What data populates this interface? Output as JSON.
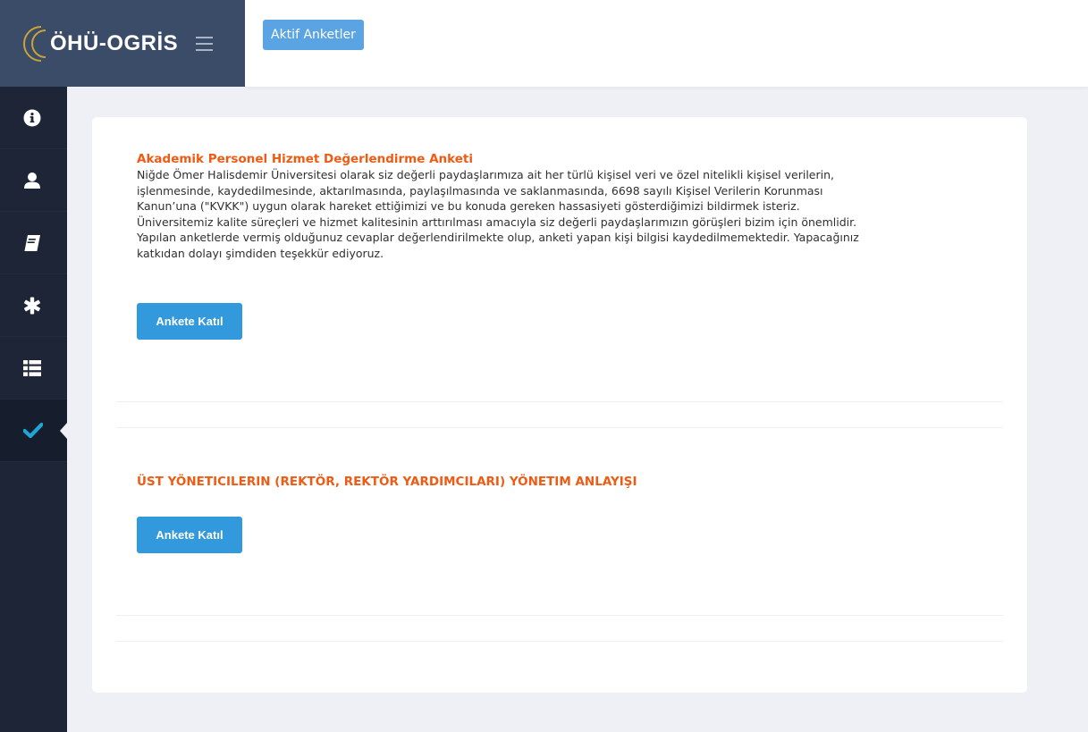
{
  "app": {
    "logo_text": "ÖHÜ-OGRİS"
  },
  "header": {
    "active_surveys_label": "Aktif Anketler"
  },
  "sidebar": {
    "items": [
      {
        "icon": "info-icon"
      },
      {
        "icon": "user-icon"
      },
      {
        "icon": "book-icon"
      },
      {
        "icon": "asterisk-icon"
      },
      {
        "icon": "list-icon"
      },
      {
        "icon": "check-icon",
        "active": true
      }
    ]
  },
  "surveys": [
    {
      "title": "Akademik Personel Hizmet Değerlendirme Anketi",
      "description": [
        "Niğde Ömer Halisdemir Üniversitesi olarak siz değerli paydaşlarımıza ait her türlü kişisel veri ve özel nitelikli kişisel verilerin,",
        "işlenmesinde, kaydedilmesinde, aktarılmasında, paylaşılmasında ve saklanmasında, 6698 sayılı Kişisel Verilerin Korunması",
        "Kanun’una (\"KVKK\") uygun olarak hareket ettiğimizi ve bu konuda gereken hassasiyeti gösterdiğimizi bildirmek isteriz.",
        "Üniversitemiz kalite süreçleri ve hizmet kalitesinin arttırılması amacıyla siz değerli paydaşlarımızın görüşleri bizim için önemlidir.",
        "Yapılan anketlerde vermiş olduğunuz cevaplar değerlendirilmekte olup, anketi yapan kişi bilgisi kaydedilmemektedir. Yapacağınız",
        "katkıdan dolayı şimdiden teşekkür ediyoruz."
      ],
      "button_label": "Ankete Katıl"
    },
    {
      "title": "ÜST YÖNETICILERIN (REKTÖR, REKTÖR YARDIMCILARI) YÖNETIM ANLAYIŞI",
      "button_label": "Ankete Katıl"
    }
  ],
  "colors": {
    "brand": "#3b4c68",
    "sidebar": "#1d2536",
    "accent_button": "#3399dd",
    "header_button": "#5aa4e4",
    "title_orange": "#f05a12",
    "logo_gold": "#c9a23a",
    "check_teal": "#1ea6d6"
  }
}
